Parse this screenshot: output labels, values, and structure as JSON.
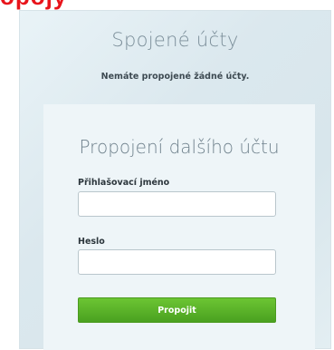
{
  "page": {
    "partial_heading": "opojy"
  },
  "linked_accounts": {
    "title": "Spojené účty",
    "empty_message": "Nemáte propojené žádné účty."
  },
  "link_form": {
    "title": "Propojení dalšího účtu",
    "username_label": "Přihlašovací jméno",
    "username_value": "",
    "password_label": "Heslo",
    "password_value": "",
    "submit_label": "Propojit"
  },
  "colors": {
    "heading_red": "#e8141b",
    "submit_green": "#5bb32a",
    "panel_bg": "#dde9ef"
  }
}
